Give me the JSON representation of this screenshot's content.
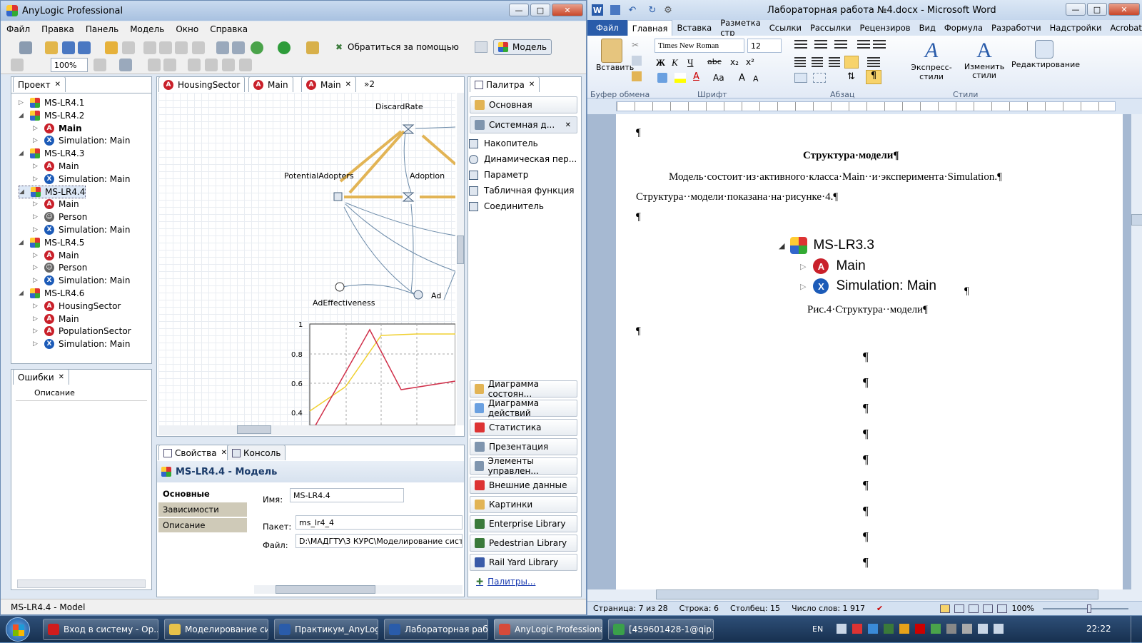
{
  "anylogic": {
    "title": "AnyLogic Professional",
    "menu": [
      "Файл",
      "Правка",
      "Панель",
      "Модель",
      "Окно",
      "Справка"
    ],
    "toolbar": {
      "zoom": "100%",
      "help_label": "Обратиться за помощью",
      "model_label": "Модель"
    },
    "project_tab": "Проект",
    "tree": [
      {
        "label": "MS-LR4.1",
        "level": 0,
        "icon": "model-icon",
        "expanded": false
      },
      {
        "label": "MS-LR4.2",
        "level": 0,
        "icon": "model-icon",
        "expanded": true
      },
      {
        "label": "Main",
        "level": 1,
        "icon": "active-class-icon",
        "bold": true
      },
      {
        "label": "Simulation: Main",
        "level": 1,
        "icon": "experiment-icon"
      },
      {
        "label": "MS-LR4.3",
        "level": 0,
        "icon": "model-icon",
        "expanded": true
      },
      {
        "label": "Main",
        "level": 1,
        "icon": "active-class-icon"
      },
      {
        "label": "Simulation: Main",
        "level": 1,
        "icon": "experiment-icon"
      },
      {
        "label": "MS-LR4.4",
        "level": 0,
        "icon": "model-icon",
        "expanded": true,
        "selected": true
      },
      {
        "label": "Main",
        "level": 1,
        "icon": "active-class-icon"
      },
      {
        "label": "Person",
        "level": 1,
        "icon": "agent-icon"
      },
      {
        "label": "Simulation: Main",
        "level": 1,
        "icon": "experiment-icon"
      },
      {
        "label": "MS-LR4.5",
        "level": 0,
        "icon": "model-icon",
        "expanded": true
      },
      {
        "label": "Main",
        "level": 1,
        "icon": "active-class-icon"
      },
      {
        "label": "Person",
        "level": 1,
        "icon": "agent-icon"
      },
      {
        "label": "Simulation: Main",
        "level": 1,
        "icon": "experiment-icon"
      },
      {
        "label": "MS-LR4.6",
        "level": 0,
        "icon": "model-icon",
        "expanded": true
      },
      {
        "label": "HousingSector",
        "level": 1,
        "icon": "active-class-icon"
      },
      {
        "label": "Main",
        "level": 1,
        "icon": "active-class-icon"
      },
      {
        "label": "PopulationSector",
        "level": 1,
        "icon": "active-class-icon"
      },
      {
        "label": "Simulation: Main",
        "level": 1,
        "icon": "experiment-icon"
      }
    ],
    "errors": {
      "tab": "Ошибки",
      "column": "Описание"
    },
    "editor_tabs": [
      "HousingSector",
      "Main",
      "Main",
      "»2"
    ],
    "diagram": {
      "labels": {
        "discard": "DiscardRate",
        "potential": "PotentialAdopters",
        "adoption": "Adoption",
        "ad_eff": "AdEffectiveness",
        "ad": "Ad"
      }
    },
    "mini_chart": {
      "yticks": [
        "1",
        "0.8",
        "0.6",
        "0.4"
      ]
    },
    "props": {
      "tabs": [
        "Свойства",
        "Консоль"
      ],
      "header": "MS-LR4.4 - Модель",
      "sections": [
        "Основные",
        "Зависимости",
        "Описание"
      ],
      "name_label": "Имя:",
      "name_value": "MS-LR4.4",
      "package_label": "Пакет:",
      "package_value": "ms_lr4_4",
      "file_label": "Файл:",
      "file_value": "D:\\МАДГТУ\\3 КУРС\\Моделирование сист"
    },
    "palette": {
      "tab": "Палитра",
      "main": "Основная",
      "sysdyn": "Системная д...",
      "items": [
        "Накопитель",
        "Динамическая пер...",
        "Параметр",
        "Табличная функция",
        "Соединитель"
      ],
      "sections": [
        "Диаграмма состоян...",
        "Диаграмма действий",
        "Статистика",
        "Презентация",
        "Элементы управлен...",
        "Внешние данные",
        "Картинки",
        "Enterprise Library",
        "Pedestrian Library",
        "Rail Yard Library"
      ],
      "link": "Палитры..."
    },
    "status": "MS-LR4.4 - Model"
  },
  "word": {
    "title": "Лабораторная работа №4.docx - Microsoft Word",
    "tabs": [
      "Файл",
      "Главная",
      "Вставка",
      "Разметка стр",
      "Ссылки",
      "Рассылки",
      "Рецензиров",
      "Вид",
      "Формула",
      "Разработчи",
      "Надстройки",
      "Acrobat"
    ],
    "ribbon": {
      "paste": "Вставить",
      "font": "Times New Roman",
      "size": "12",
      "groups": [
        "Буфер обмена",
        "Шрифт",
        "Абзац",
        "Стили"
      ],
      "express_styles": "Экспресс-стили",
      "change_styles": "Изменить стили",
      "editing": "Редактирование"
    },
    "doc": {
      "pilcrow": "¶",
      "heading": "Структура·модели¶",
      "p1": "Модель·состоит·из·активного·класса·Main··и·эксперимента·Simulation.¶",
      "p2": "Структура··модели·показана·на·рисунке·4.¶",
      "fig_model": "MS-LR3.3",
      "fig_main": "Main",
      "fig_sim": "Simulation: Main",
      "caption": "Рис.4·Структура··модели¶"
    },
    "status": {
      "page": "Страница: 7 из 28",
      "line": "Строка: 6",
      "col": "Столбец: 15",
      "words": "Число слов: 1 917",
      "zoom": "100%"
    }
  },
  "taskbar": {
    "items": [
      {
        "label": "Вход в систему - Op...",
        "color": "#d01c1c"
      },
      {
        "label": "Моделирование си...",
        "color": "#e8c24a"
      },
      {
        "label": "Практикум_AnyLogi...",
        "color": "#2a5caa"
      },
      {
        "label": "Лабораторная рабо...",
        "color": "#2a5caa"
      },
      {
        "label": "AnyLogic Professional",
        "color": "#d64a3a"
      },
      {
        "label": "[459601428-1@qip.ru...",
        "color": "#3aa04a"
      }
    ],
    "lang": "EN",
    "clock": "22:22"
  }
}
